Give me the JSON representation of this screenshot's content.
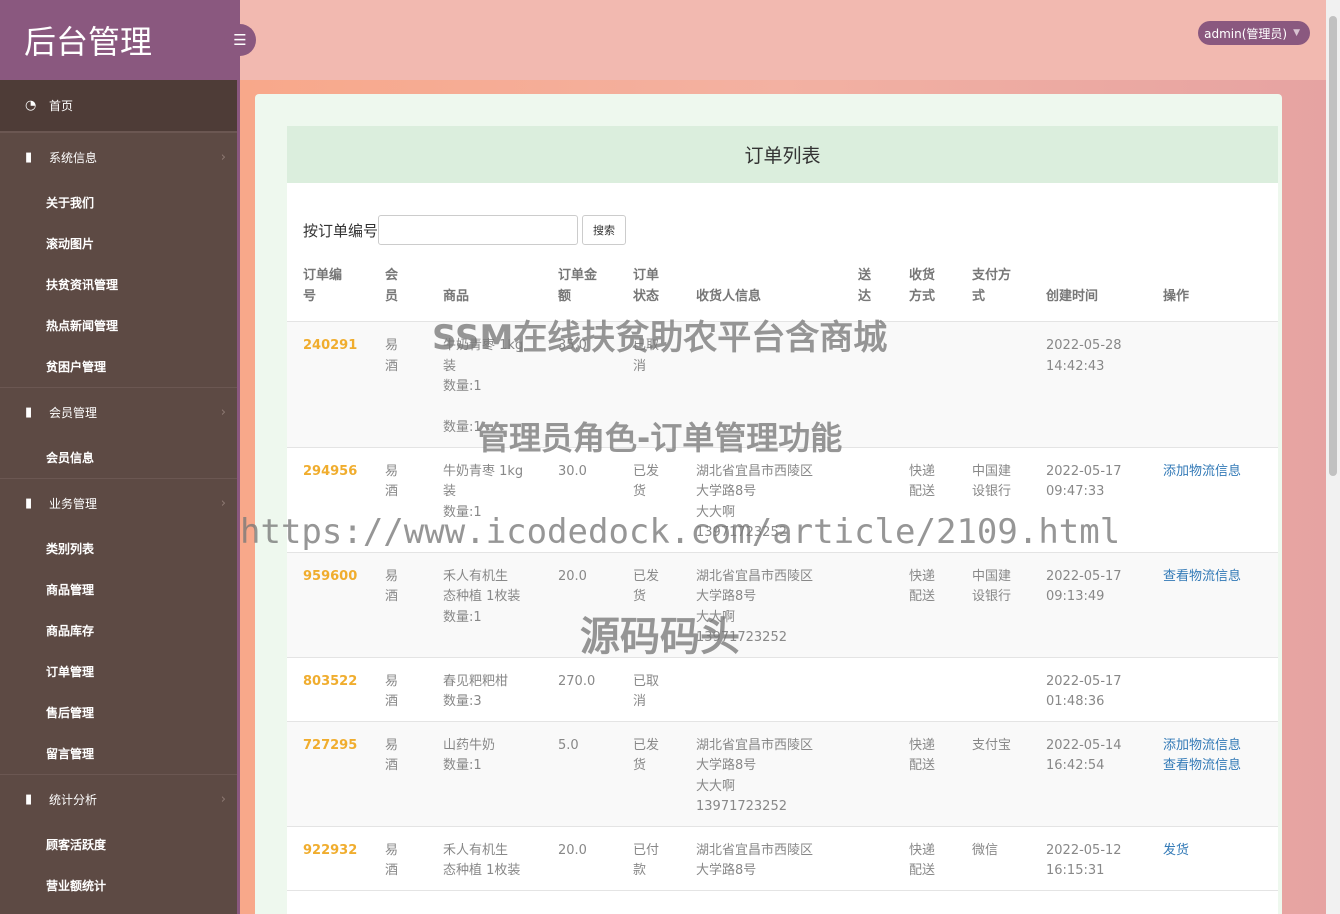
{
  "brand": {
    "title": "后台管理"
  },
  "header": {
    "user": "admin(管理员)"
  },
  "sidebar": {
    "home": "首页",
    "groups": [
      {
        "label": "系统信息",
        "items": [
          "关于我们",
          "滚动图片",
          "扶贫资讯管理",
          "热点新闻管理",
          "贫困户管理"
        ]
      },
      {
        "label": "会员管理",
        "items": [
          "会员信息"
        ]
      },
      {
        "label": "业务管理",
        "items": [
          "类别列表",
          "商品管理",
          "商品库存",
          "订单管理",
          "售后管理",
          "留言管理"
        ]
      },
      {
        "label": "统计分析",
        "items": [
          "顾客活跃度",
          "营业额统计"
        ]
      }
    ]
  },
  "main": {
    "title": "订单列表",
    "search": {
      "label": "按订单编号",
      "value": "",
      "button": "搜索"
    },
    "columns": {
      "order_no": [
        "订单编",
        "号"
      ],
      "member": [
        "会",
        "员"
      ],
      "product": "商品",
      "amount": [
        "订单金",
        "额"
      ],
      "status": [
        "订单",
        "状态"
      ],
      "receiver": "收货人信息",
      "delivery": [
        "送",
        "达"
      ],
      "receive_method": [
        "收货",
        "方式"
      ],
      "pay_method": [
        "支付方",
        "式"
      ],
      "created": "创建时间",
      "actions": "操作"
    },
    "rows": [
      {
        "order_no": "240291",
        "member": [
          "易",
          "酒"
        ],
        "product": [
          "牛奶青枣 1kg",
          "装",
          "数量:1",
          "",
          "数量:1"
        ],
        "amount": "35.0",
        "status": [
          "已取",
          "消"
        ],
        "receiver": [],
        "delivery": [],
        "receive_method": [],
        "pay_method": [],
        "created": [
          "2022-05-28",
          "14:42:43"
        ],
        "actions": []
      },
      {
        "order_no": "294956",
        "member": [
          "易",
          "酒"
        ],
        "product": [
          "牛奶青枣 1kg",
          "装",
          "数量:1"
        ],
        "amount": "30.0",
        "status": [
          "已发",
          "货"
        ],
        "receiver": [
          "湖北省宜昌市西陵区",
          "大学路8号",
          "大大啊",
          "13971723252"
        ],
        "delivery": [],
        "receive_method": [
          "快递",
          "配送"
        ],
        "pay_method": [
          "中国建",
          "设银行"
        ],
        "created": [
          "2022-05-17",
          "09:47:33"
        ],
        "actions": [
          "添加物流信息"
        ]
      },
      {
        "order_no": "959600",
        "member": [
          "易",
          "酒"
        ],
        "product": [
          "禾人有机生",
          "态种植 1枚装",
          "数量:1"
        ],
        "amount": "20.0",
        "status": [
          "已发",
          "货"
        ],
        "receiver": [
          "湖北省宜昌市西陵区",
          "大学路8号",
          "大大啊",
          "13971723252"
        ],
        "delivery": [],
        "receive_method": [
          "快递",
          "配送"
        ],
        "pay_method": [
          "中国建",
          "设银行"
        ],
        "created": [
          "2022-05-17",
          "09:13:49"
        ],
        "actions": [
          "查看物流信息"
        ]
      },
      {
        "order_no": "803522",
        "member": [
          "易",
          "酒"
        ],
        "product": [
          "春见粑粑柑",
          "数量:3"
        ],
        "amount": "270.0",
        "status": [
          "已取",
          "消"
        ],
        "receiver": [],
        "delivery": [],
        "receive_method": [],
        "pay_method": [],
        "created": [
          "2022-05-17",
          "01:48:36"
        ],
        "actions": []
      },
      {
        "order_no": "727295",
        "member": [
          "易",
          "酒"
        ],
        "product": [
          "山药牛奶",
          "数量:1"
        ],
        "amount": "5.0",
        "status": [
          "已发",
          "货"
        ],
        "receiver": [
          "湖北省宜昌市西陵区",
          "大学路8号",
          "大大啊",
          "13971723252"
        ],
        "delivery": [],
        "receive_method": [
          "快递",
          "配送"
        ],
        "pay_method": [
          "支付宝"
        ],
        "created": [
          "2022-05-14",
          "16:42:54"
        ],
        "actions": [
          "添加物流信息",
          "查看物流信息"
        ]
      },
      {
        "order_no": "922932",
        "member": [
          "易",
          "酒"
        ],
        "product": [
          "禾人有机生",
          "态种植 1枚装"
        ],
        "amount": "20.0",
        "status": [
          "已付",
          "款"
        ],
        "receiver": [
          "湖北省宜昌市西陵区",
          "大学路8号"
        ],
        "delivery": [],
        "receive_method": [
          "快递",
          "配送"
        ],
        "pay_method": [
          "微信"
        ],
        "created": [
          "2022-05-12",
          "16:15:31"
        ],
        "actions": [
          "发货"
        ]
      }
    ]
  },
  "watermarks": [
    "SSM在线扶贫助农平台含商城",
    "管理员角色-订单管理功能",
    "https://www.icodedock.com/article/2109.html",
    "源码码头"
  ]
}
